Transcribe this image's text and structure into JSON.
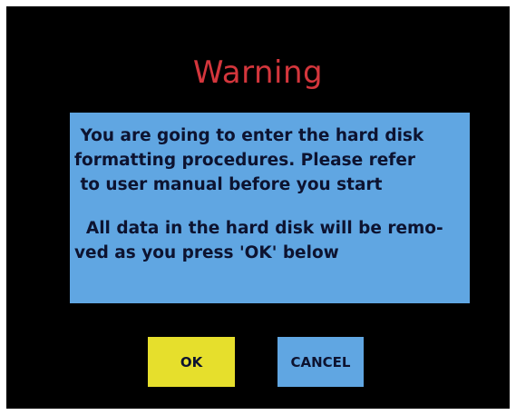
{
  "dialog": {
    "title": "Warning",
    "message_lines": [
      " You are going to enter the hard disk\nformatting procedures. Please refer\n to user manual before you start",
      "  All data in the hard disk will be remo-\nved as you press 'OK' below"
    ]
  },
  "buttons": {
    "ok_label": "OK",
    "cancel_label": "CANCEL"
  },
  "colors": {
    "background": "#000000",
    "title": "#d4363c",
    "panel": "#60a6e2",
    "ok_button": "#e6df2c",
    "cancel_button": "#60a6e2",
    "text": "#0d1330"
  }
}
